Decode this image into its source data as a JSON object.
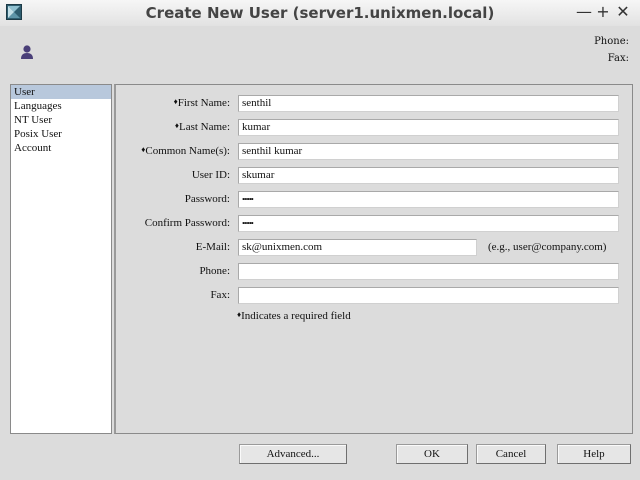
{
  "window": {
    "title": "Create New User (server1.unixmen.local)",
    "controls": {
      "close": "✕",
      "maximize": "+",
      "minimize": "—"
    }
  },
  "header": {
    "phone_label": "Phone:",
    "fax_label": "Fax:"
  },
  "sidebar": {
    "items": [
      {
        "label": "User",
        "selected": true
      },
      {
        "label": "Languages",
        "selected": false
      },
      {
        "label": "NT User",
        "selected": false
      },
      {
        "label": "Posix User",
        "selected": false
      },
      {
        "label": "Account",
        "selected": false
      }
    ]
  },
  "form": {
    "required_marker": "♦",
    "fields": [
      {
        "label": "First Name:",
        "required": true,
        "value": "senthil"
      },
      {
        "label": "Last Name:",
        "required": true,
        "value": "kumar"
      },
      {
        "label": "Common Name(s):",
        "required": true,
        "value": "senthil kumar"
      },
      {
        "label": "User ID:",
        "required": false,
        "value": "skumar"
      },
      {
        "label": "Password:",
        "required": false,
        "value": "••••••"
      },
      {
        "label": "Confirm Password:",
        "required": false,
        "value": "••••••"
      },
      {
        "label": "E-Mail:",
        "required": false,
        "value": "sk@unixmen.com",
        "hint": "(e.g., user@company.com)"
      },
      {
        "label": "Phone:",
        "required": false,
        "value": ""
      },
      {
        "label": "Fax:",
        "required": false,
        "value": ""
      }
    ],
    "required_note": "Indicates a required field"
  },
  "buttons": {
    "advanced": "Advanced...",
    "ok": "OK",
    "cancel": "Cancel",
    "help": "Help"
  },
  "icons": {
    "app": "directory-server-icon",
    "user": "user-icon"
  },
  "colors": {
    "background": "#dcdcdc",
    "selection": "#b8c8dc",
    "field_bg": "#ffffff",
    "user_icon": "#4a3f78"
  }
}
